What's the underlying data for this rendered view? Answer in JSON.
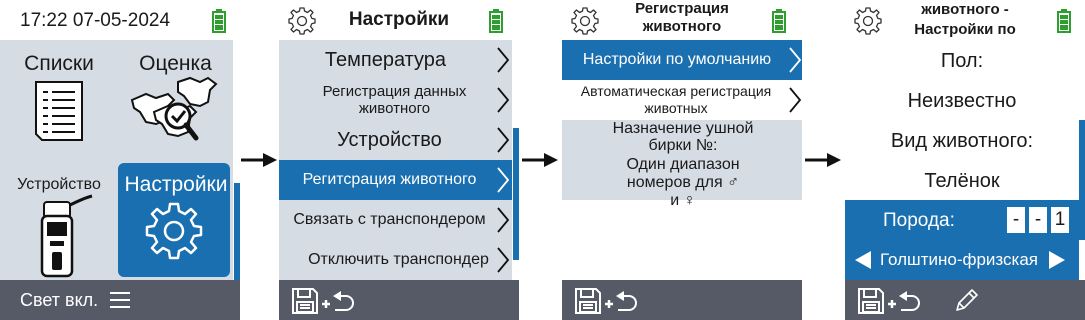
{
  "screen1": {
    "datetime": "17:22 07-05-2024",
    "tiles": [
      {
        "label": "Списки",
        "icon": "document-list-icon"
      },
      {
        "label": "Оценка",
        "icon": "cow-inspect-icon"
      },
      {
        "label": "Устройство",
        "icon": "reader-device-icon"
      },
      {
        "label": "Настройки",
        "icon": "gear-icon"
      }
    ],
    "footer_label": "Свет вкл."
  },
  "screen2": {
    "title": "Настройки",
    "items": [
      {
        "label": "Температура"
      },
      {
        "label": "Регистрация данных животного"
      },
      {
        "label": "Устройство"
      },
      {
        "label": "Регитсрация животного"
      },
      {
        "label": "Связать с транспондером"
      },
      {
        "label": "Отключить транспондер"
      }
    ]
  },
  "screen3": {
    "title": "Регистрация животного",
    "items": [
      {
        "label": "Настройки по умолчанию"
      },
      {
        "label": "Автоматическая регистрация животных"
      }
    ],
    "info_title": "Назначение ушной бирки №:",
    "info_value": "Один диапазон номеров для ♂ и ♀"
  },
  "screen4": {
    "title": "животного - Настройки по",
    "sex_label": "Пол:",
    "sex_value": "Неизвестно",
    "type_label": "Вид животного:",
    "type_value": "Телёнок",
    "breed_label": "Порода:",
    "breed_digits": [
      "-",
      "-",
      "1"
    ],
    "breed_value": "Голштино-фризская"
  },
  "colors": {
    "accent": "#1a6fb0",
    "panel": "#d5dce4",
    "footer": "#555a66",
    "battery": "#2e9e2e"
  }
}
